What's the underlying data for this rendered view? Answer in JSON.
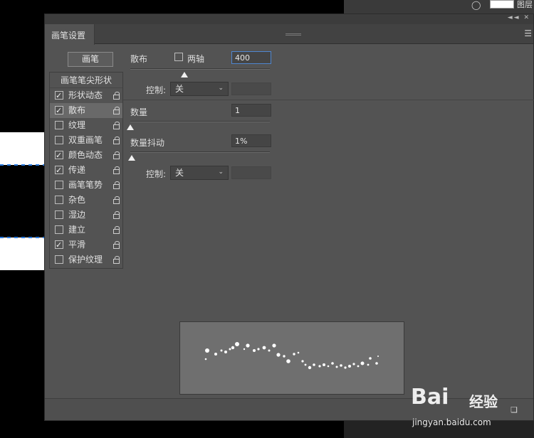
{
  "panel": {
    "tab_title": "画笔设置",
    "brush_button": "画笔",
    "list_header": "画笔笔尖形状",
    "items": [
      {
        "label": "形状动态",
        "checked": true,
        "active": false
      },
      {
        "label": "散布",
        "checked": true,
        "active": true
      },
      {
        "label": "纹理",
        "checked": false,
        "active": false
      },
      {
        "label": "双重画笔",
        "checked": false,
        "active": false
      },
      {
        "label": "颜色动态",
        "checked": true,
        "active": false
      },
      {
        "label": "传递",
        "checked": true,
        "active": false
      },
      {
        "label": "画笔笔势",
        "checked": false,
        "active": false
      },
      {
        "label": "杂色",
        "checked": false,
        "active": false
      },
      {
        "label": "湿边",
        "checked": false,
        "active": false
      },
      {
        "label": "建立",
        "checked": false,
        "active": false
      },
      {
        "label": "平滑",
        "checked": true,
        "active": false
      },
      {
        "label": "保护纹理",
        "checked": false,
        "active": false
      }
    ]
  },
  "scatter": {
    "label": "散布",
    "both_axes_label": "两轴",
    "both_axes_checked": false,
    "value": "400",
    "slider_fraction": 0.39,
    "control_label": "控制:",
    "control_value": "关"
  },
  "count": {
    "label": "数量",
    "value": "1",
    "slider_fraction": 0.0
  },
  "count_jitter": {
    "label": "数量抖动",
    "value": "1%",
    "slider_fraction": 0.01,
    "control_label": "控制:",
    "control_value": "关"
  },
  "topstrip": {
    "layer_text": "图层"
  },
  "watermark": {
    "main": "Bai",
    "cn": "经验",
    "url": "jingyan.baidu.com"
  },
  "colors": {
    "accent": "#4f86d0",
    "selection": "#2a7be0"
  }
}
